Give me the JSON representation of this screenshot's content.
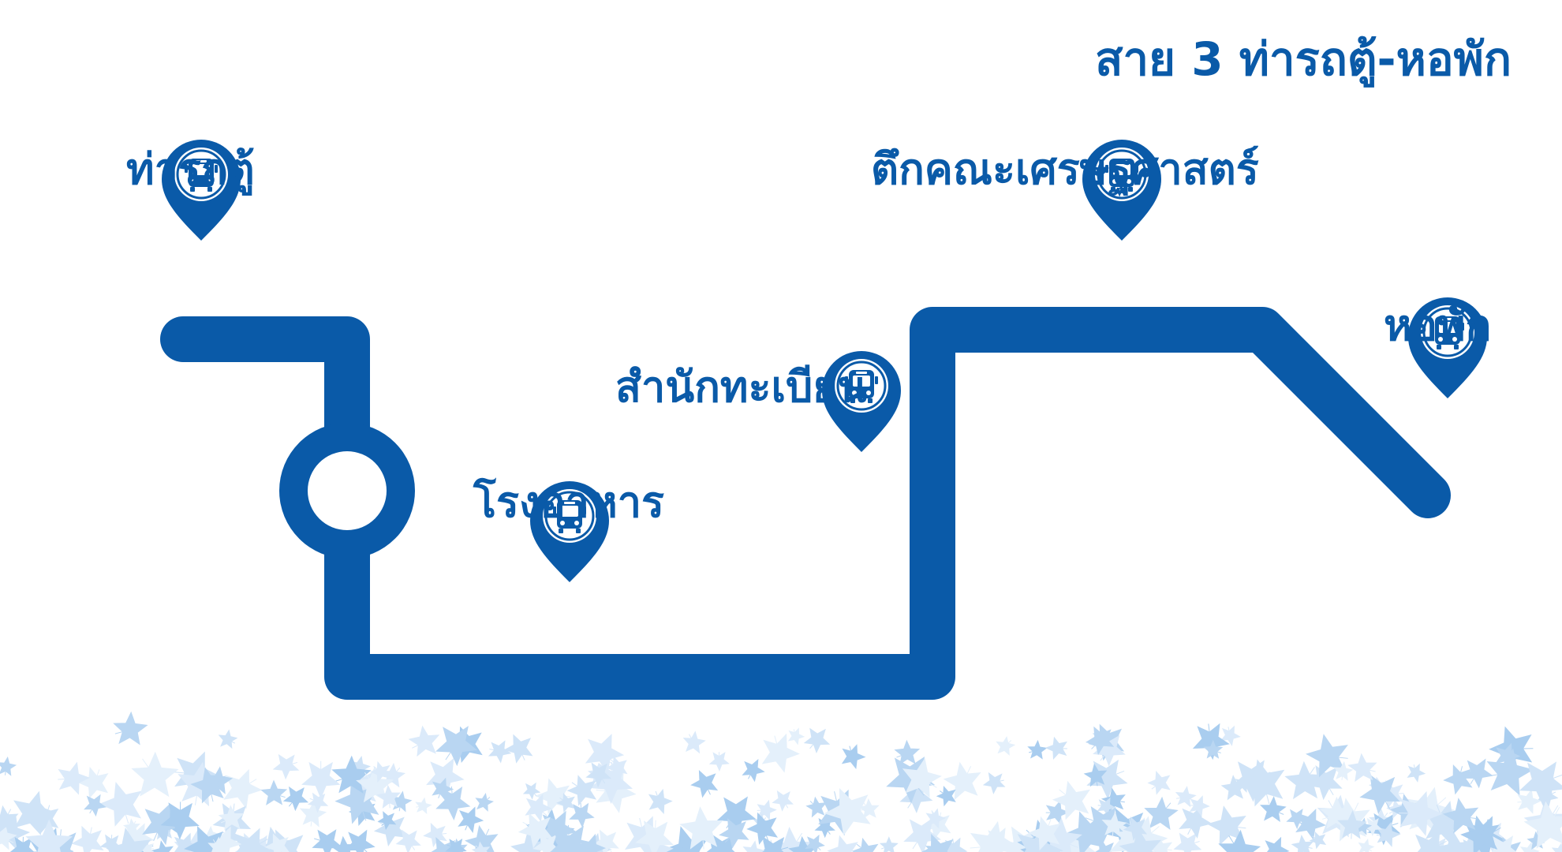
{
  "route": {
    "title": "สาย 3 ท่ารถตู้-หอพัก"
  },
  "stops": [
    {
      "id": "s1",
      "name": "ท่ารถตู้",
      "icon": "bus-stop-pin-icon"
    },
    {
      "id": "s2",
      "name": "โรงอาหาร",
      "icon": "bus-stop-pin-icon"
    },
    {
      "id": "s3",
      "name": "สำนักทะเบียน",
      "icon": "bus-stop-pin-icon"
    },
    {
      "id": "s4",
      "name": "ตึกคณะเศรษฐศาสตร์",
      "icon": "bus-stop-pin-icon"
    },
    {
      "id": "s5",
      "name": "หอพัก",
      "icon": "bus-stop-pin-icon"
    }
  ],
  "decorations": {
    "roundabout": "roundabout-icon",
    "footer": "maple-leaves-decoration"
  },
  "colors": {
    "route": "#0a5aa8",
    "leaves": "#cfe3f7",
    "background": "#ffffff"
  }
}
